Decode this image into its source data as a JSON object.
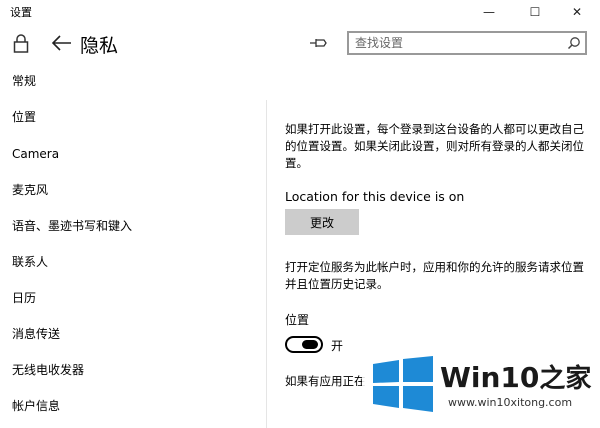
{
  "window": {
    "title": "设置",
    "controls": {
      "minimize": "—",
      "maximize": "☐",
      "close": "✕"
    }
  },
  "header": {
    "title": "隐私",
    "search_placeholder": "查找设置"
  },
  "sidebar": {
    "items": [
      {
        "label": "常规"
      },
      {
        "label": "位置"
      },
      {
        "label": "Camera"
      },
      {
        "label": "麦克风"
      },
      {
        "label": "语音、墨迹书写和键入"
      },
      {
        "label": "联系人"
      },
      {
        "label": "日历"
      },
      {
        "label": "消息传送"
      },
      {
        "label": "无线电收发器"
      },
      {
        "label": "帐户信息"
      }
    ]
  },
  "main": {
    "description_1": "如果打开此设置，每个登录到这台设备的人都可以更改自己的位置设置。如果关闭此设置，则对所有登录的人都关闭位置。",
    "location_status": "Location for this device is on",
    "change_button": "更改",
    "description_2": "打开定位服务为此帐户时，应用和你的允许的服务请求位置并且位置历史记录。",
    "location_heading": "位置",
    "toggle": {
      "state": "on",
      "label": "开"
    },
    "description_3": "如果有应用正在"
  },
  "watermark": {
    "brand_prefix": "Win10",
    "brand_suffix": "之家",
    "url": "www.win10xitong.com",
    "colors": {
      "logo_blue": "#1e8ad6"
    }
  }
}
